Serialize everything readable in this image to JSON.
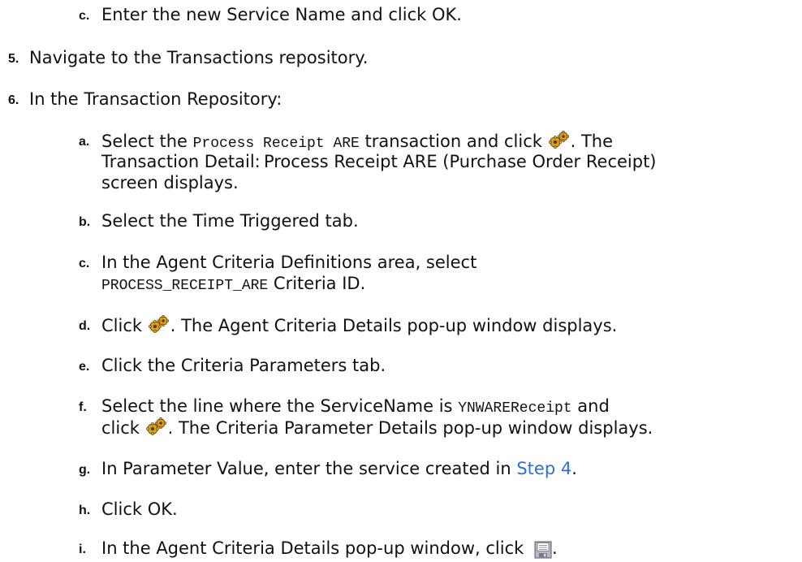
{
  "steps": {
    "s4c": {
      "marker": "c.",
      "text": "Enter the new Service Name and click OK."
    },
    "s5": {
      "marker": "5.",
      "text": "Navigate to the Transactions repository."
    },
    "s6": {
      "marker": "6.",
      "text": "In the Transaction Repository:"
    },
    "a": {
      "marker": "a.",
      "t1": "Select the ",
      "code": "Process Receipt ARE",
      "t2": " transaction and click ",
      "t3": ". The",
      "line2": "Transaction Detail: Process Receipt ARE (Purchase Order Receipt)",
      "line3": "screen displays."
    },
    "b": {
      "marker": "b.",
      "text": "Select the Time Triggered tab."
    },
    "c": {
      "marker": "c.",
      "line1": "In the Agent Criteria Definitions area, select",
      "code": "PROCESS_RECEIPT_ARE",
      "t2": " Criteria ID."
    },
    "d": {
      "marker": "d.",
      "t1": "Click ",
      "t2": ". The Agent Criteria Details pop-up window displays."
    },
    "e": {
      "marker": "e.",
      "text": "Click the Criteria Parameters tab."
    },
    "f": {
      "marker": "f.",
      "t1": "Select the line where the ServiceName is ",
      "code": "YNWAREReceipt",
      "t2": " and",
      "l2a": "click ",
      "l2b": ". The Criteria Parameter Details pop-up window displays."
    },
    "g": {
      "marker": "g.",
      "t1": "In Parameter Value, enter the service created in ",
      "link": "Step 4",
      "t2": "."
    },
    "h": {
      "marker": "h.",
      "text": "Click OK."
    },
    "i": {
      "marker": "i.",
      "t1": "In the Agent Criteria Details pop-up window, click ",
      "t2": "."
    }
  },
  "icons": {
    "details": "gear-details-icon",
    "save": "save-icon"
  },
  "colors": {
    "link": "#2e6fd8",
    "gear_gold": "#d9a21b",
    "gear_dark": "#5a3a08"
  }
}
